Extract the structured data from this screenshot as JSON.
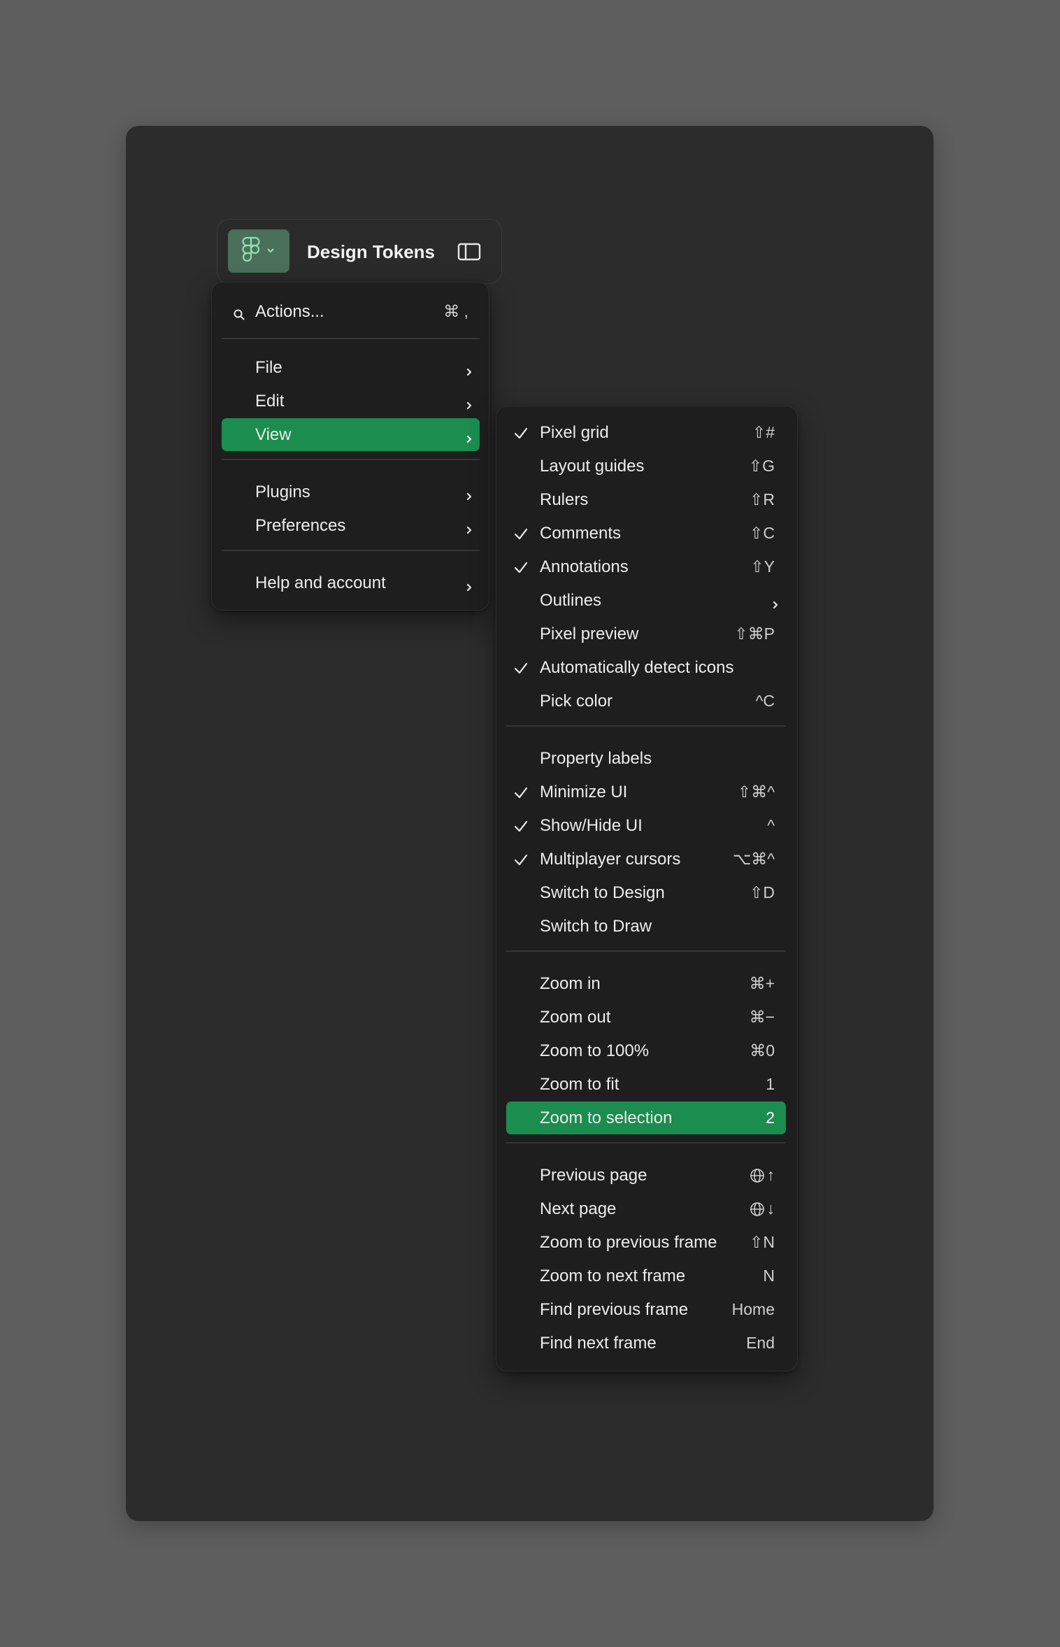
{
  "toolbar": {
    "title": "Design Tokens",
    "icons": {
      "logo": "figma-logo-icon",
      "chevron": "chevron-down-icon",
      "sidebar": "sidebar-toggle-icon"
    },
    "accent": "#4a6f5b"
  },
  "main_menu": {
    "search": {
      "label": "Actions...",
      "shortcut": "⌘ ,"
    },
    "groups": [
      [
        {
          "label": "File"
        },
        {
          "label": "Edit"
        },
        {
          "label": "View",
          "active": true
        }
      ],
      [
        {
          "label": "Plugins"
        },
        {
          "label": "Preferences"
        }
      ],
      [
        {
          "label": "Help and account"
        }
      ]
    ]
  },
  "view_menu": {
    "groups": [
      [
        {
          "label": "Pixel grid",
          "shortcut": "⇧#",
          "checked": true
        },
        {
          "label": "Layout guides",
          "shortcut": "⇧G",
          "checked": false
        },
        {
          "label": "Rulers",
          "shortcut": "⇧R",
          "checked": false
        },
        {
          "label": "Comments",
          "shortcut": "⇧C",
          "checked": true
        },
        {
          "label": "Annotations",
          "shortcut": "⇧Y",
          "checked": true
        },
        {
          "label": "Outlines",
          "shortcut": "",
          "checked": false,
          "submenu": true
        },
        {
          "label": "Pixel preview",
          "shortcut": "⇧⌘P",
          "checked": false
        },
        {
          "label": "Automatically detect icons",
          "shortcut": "",
          "checked": true
        },
        {
          "label": "Pick color",
          "shortcut": "^C",
          "checked": false
        }
      ],
      [
        {
          "label": "Property labels",
          "shortcut": "",
          "checked": false
        },
        {
          "label": "Minimize UI",
          "shortcut": "⇧⌘^",
          "checked": true
        },
        {
          "label": "Show/Hide UI",
          "shortcut": "^",
          "checked": true
        },
        {
          "label": "Multiplayer cursors",
          "shortcut": "⌥⌘^",
          "checked": true
        },
        {
          "label": "Switch to Design",
          "shortcut": "⇧D",
          "checked": false
        },
        {
          "label": "Switch to Draw",
          "shortcut": "",
          "checked": false
        }
      ],
      [
        {
          "label": "Zoom in",
          "shortcut": "⌘+",
          "checked": false
        },
        {
          "label": "Zoom out",
          "shortcut": "⌘−",
          "checked": false
        },
        {
          "label": "Zoom to 100%",
          "shortcut": "⌘0",
          "checked": false
        },
        {
          "label": "Zoom to fit",
          "shortcut": "1",
          "checked": false
        },
        {
          "label": "Zoom to selection",
          "shortcut": "2",
          "checked": false,
          "active": true
        }
      ],
      [
        {
          "label": "Previous page",
          "shortcut": "↑",
          "globe": true
        },
        {
          "label": "Next page",
          "shortcut": "↓",
          "globe": true
        },
        {
          "label": "Zoom to previous frame",
          "shortcut": "⇧N"
        },
        {
          "label": "Zoom to next frame",
          "shortcut": "N"
        },
        {
          "label": "Find previous frame",
          "shortcut": "Home"
        },
        {
          "label": "Find next frame",
          "shortcut": "End"
        }
      ]
    ],
    "active_color": "#1b8d4f"
  }
}
